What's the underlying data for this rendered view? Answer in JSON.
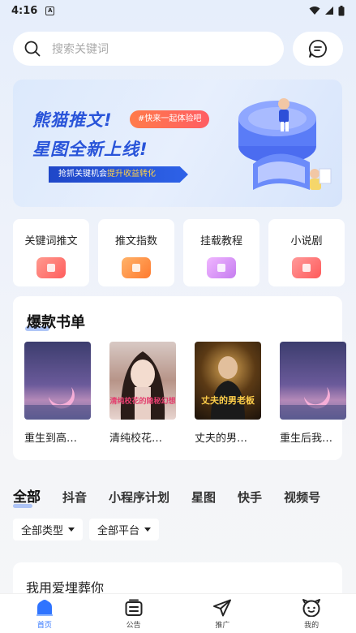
{
  "status_bar": {
    "time": "4:16",
    "notif_badge": "A"
  },
  "search": {
    "placeholder": "搜索关键词",
    "icon": "search-icon",
    "message_icon": "message-icon"
  },
  "banner": {
    "title_line1": "熊猫推文!",
    "title_line2": "星图全新上线!",
    "pill": "#快来一起体验吧",
    "strip_prefix": "抢抓关键机会",
    "strip_highlight": "提升收益转化"
  },
  "quick_actions": [
    {
      "label": "关键词推文",
      "color": "#ff6d6a"
    },
    {
      "label": "推文指数",
      "color": "#ff8a3d"
    },
    {
      "label": "挂载教程",
      "color": "#d98cf5"
    },
    {
      "label": "小说剧",
      "color": "#ff6b6b"
    }
  ],
  "hot_section": {
    "title": "爆款书单",
    "books": [
      {
        "title": "重生到高…"
      },
      {
        "title": "清纯校花…",
        "cover_text": "清纯校花的隐秘幻想"
      },
      {
        "title": "丈夫的男…",
        "cover_text": "丈夫的男老板"
      },
      {
        "title": "重生后我…"
      }
    ]
  },
  "tabs": [
    {
      "label": "全部",
      "active": true
    },
    {
      "label": "抖音"
    },
    {
      "label": "小程序计划"
    },
    {
      "label": "星图"
    },
    {
      "label": "快手"
    },
    {
      "label": "视频号"
    }
  ],
  "filters": [
    {
      "label": "全部类型"
    },
    {
      "label": "全部平台"
    }
  ],
  "list_card": {
    "title": "我用爱埋葬你"
  },
  "bottom_nav": [
    {
      "label": "首页",
      "icon": "home-icon",
      "active": true
    },
    {
      "label": "公告",
      "icon": "announcement-icon"
    },
    {
      "label": "推广",
      "icon": "send-icon"
    },
    {
      "label": "我的",
      "icon": "profile-icon"
    }
  ],
  "colors": {
    "accent": "#2f74ff",
    "banner_text": "#2954d9"
  }
}
